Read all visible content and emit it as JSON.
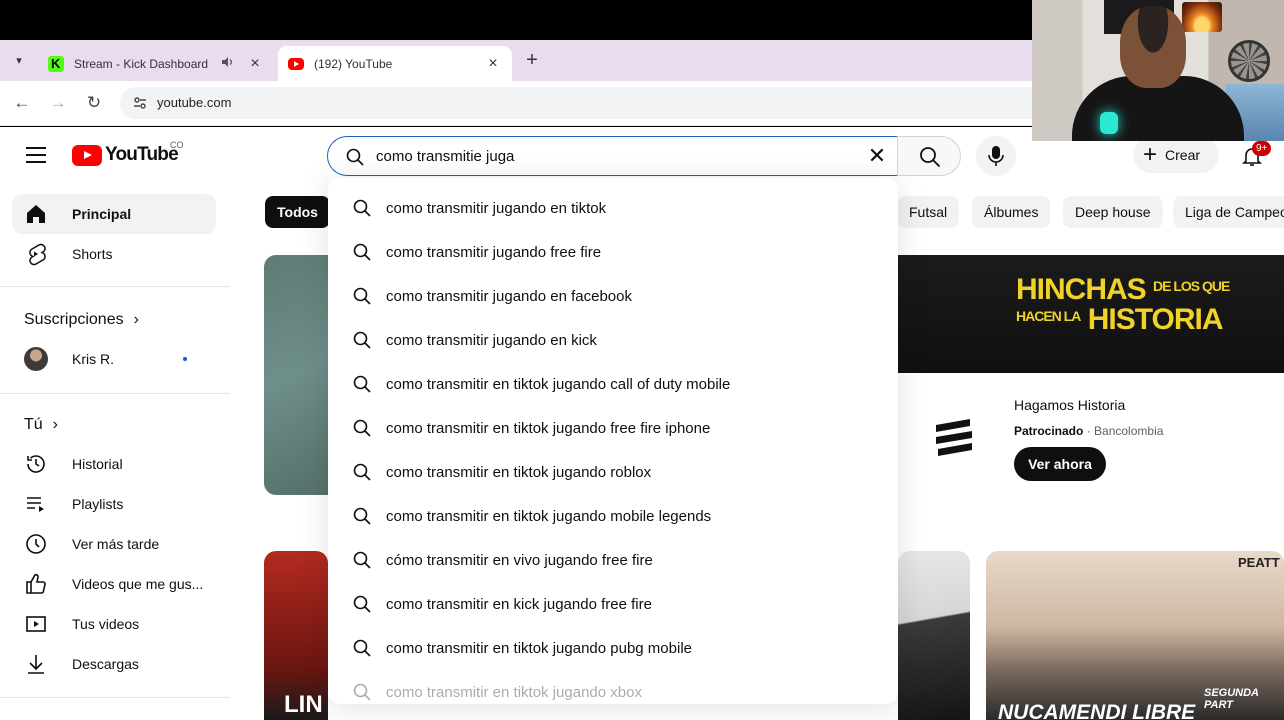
{
  "browser": {
    "tabs": [
      {
        "title": "Stream - Kick Dashboard",
        "favicon": "kick-icon"
      },
      {
        "title": "(192) YouTube",
        "favicon": "youtube-icon"
      }
    ],
    "new_tab_label": "+",
    "url": "youtube.com"
  },
  "header": {
    "logo_text": "YouTube",
    "country_code": "CO",
    "search_value": "como transmitie juga",
    "create_label": "Crear",
    "notification_badge": "9+"
  },
  "sidebar": {
    "main": [
      {
        "label": "Principal",
        "icon": "home-icon"
      },
      {
        "label": "Shorts",
        "icon": "shorts-icon"
      }
    ],
    "subscriptions_heading": "Suscripciones",
    "subscriptions": [
      {
        "label": "Kris R."
      }
    ],
    "you_heading": "Tú",
    "you": [
      {
        "label": "Historial",
        "icon": "history-icon"
      },
      {
        "label": "Playlists",
        "icon": "playlists-icon"
      },
      {
        "label": "Ver más tarde",
        "icon": "watch-later-icon"
      },
      {
        "label": "Videos que me gus...",
        "icon": "like-icon"
      },
      {
        "label": "Tus videos",
        "icon": "your-videos-icon"
      },
      {
        "label": "Descargas",
        "icon": "download-icon"
      }
    ]
  },
  "chips": [
    "Todos",
    "Futsal",
    "Álbumes",
    "Deep house",
    "Liga de Campeo"
  ],
  "suggestions": [
    "como transmitir jugando en tiktok",
    "como transmitir jugando free fire",
    "como transmitir jugando en facebook",
    "como transmitir jugando en kick",
    "como transmitir en tiktok jugando call of duty mobile",
    "como transmitir en tiktok jugando free fire iphone",
    "como transmitir en tiktok jugando roblox",
    "como transmitir en tiktok jugando mobile legends",
    "cómo transmitir en vivo jugando free fire",
    "como transmitir en kick jugando free fire",
    "como transmitir en tiktok jugando pubg mobile",
    "como transmitir en tiktok jugando xbox"
  ],
  "ad": {
    "headline_line1_big": "HINCHAS",
    "headline_line1_small": "DE LOS QUE",
    "headline_line2_small": "HACEN LA",
    "headline_line2_big": "HISTORIA",
    "title": "Hagamos Historia",
    "sponsored_label": "Patrocinado",
    "sponsor": "Bancolombia",
    "cta": "Ver ahora"
  },
  "video_thumbs": {
    "left_text": "LIN",
    "right_badge": "SEGUNDA PART",
    "right_title": "NUCAMENDI LIBRE",
    "right_logo": "PEATT"
  },
  "colors": {
    "youtube_red": "#ff0000",
    "focus_blue": "#1c62b9",
    "kick_green": "#53fc18",
    "ad_yellow": "#f0d229"
  }
}
